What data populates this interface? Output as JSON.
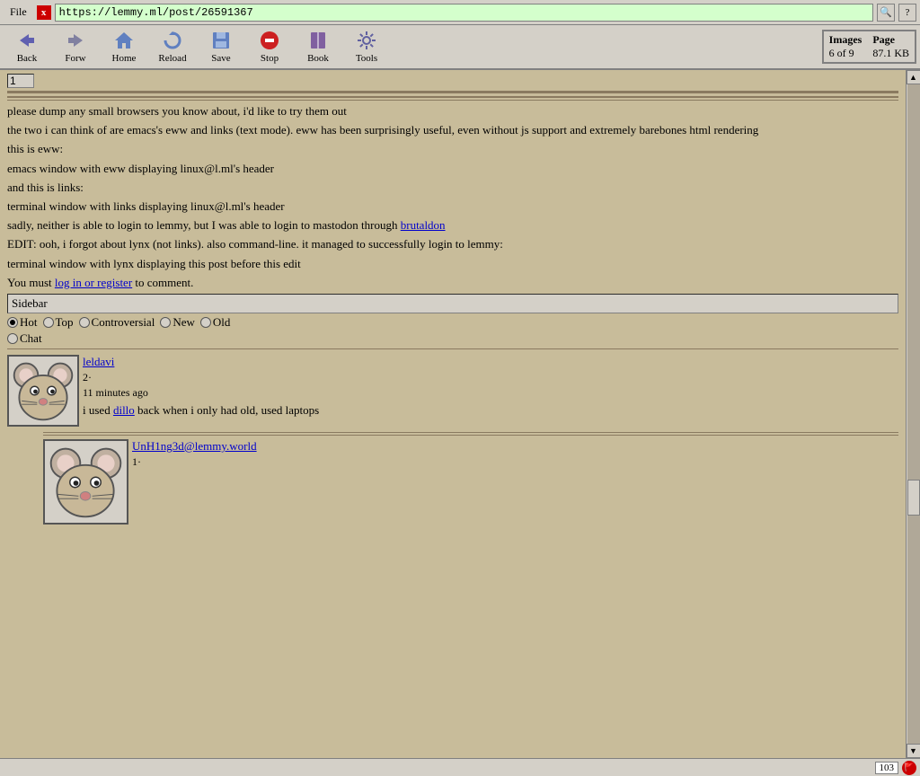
{
  "titlebar": {
    "file_label": "File",
    "close_x": "x",
    "url": "https://lemmy.ml/post/26591367",
    "search_symbol": "🔍"
  },
  "toolbar": {
    "back_label": "Back",
    "forward_label": "Forw",
    "home_label": "Home",
    "reload_label": "Reload",
    "save_label": "Save",
    "stop_label": "Stop",
    "book_label": "Book",
    "tools_label": "Tools"
  },
  "info_box": {
    "images_label": "Images",
    "images_value": "6 of 9",
    "page_label": "Page",
    "page_value": "87.1 KB"
  },
  "content": {
    "number_input": "1",
    "para1": "please dump any small browsers you know about, i'd like to try them out",
    "para2": "the two i can think of are emacs's eww and links (text mode). eww has been surprisingly useful, even without js support and extremely barebones html rendering",
    "para3": "this is eww:",
    "para4": "emacs window with eww displaying linux@l.ml's header",
    "para5": "and this is links:",
    "para6": "terminal window with links displaying linux@l.ml's header",
    "para7_pre": "sadly, neither is able to login to lemmy, but I was able to login to mastodon through ",
    "para7_link": "brutaldon",
    "para7_href": "#",
    "para8": "EDIT: ooh, i forgot about lynx (not links). also command-line. it managed to successfully login to lemmy:",
    "para9": "terminal window with lynx displaying this post before this edit",
    "login_pre": "You must ",
    "login_link": "log in or register",
    "login_href": "#",
    "login_post": " to comment.",
    "sidebar_label": "Sidebar",
    "sort_hot": "Hot",
    "sort_top": "Top",
    "sort_controversial": "Controversial",
    "sort_new": "New",
    "sort_old": "Old",
    "sort_chat": "Chat",
    "comment1": {
      "username": "leldavi",
      "score": "2·",
      "time": "11 minutes ago",
      "text_pre": "i used ",
      "text_link": "dillo",
      "text_link_href": "#",
      "text_post": " back when i only had old, used laptops"
    },
    "comment2": {
      "username": "UnH1ng3d@lemmy.world",
      "score": "1·"
    }
  },
  "statusbar": {
    "num": "103"
  },
  "colors": {
    "bg_content": "#c8bc9a",
    "bg_toolbar": "#d4d0c8",
    "link_color": "#0000cc"
  }
}
